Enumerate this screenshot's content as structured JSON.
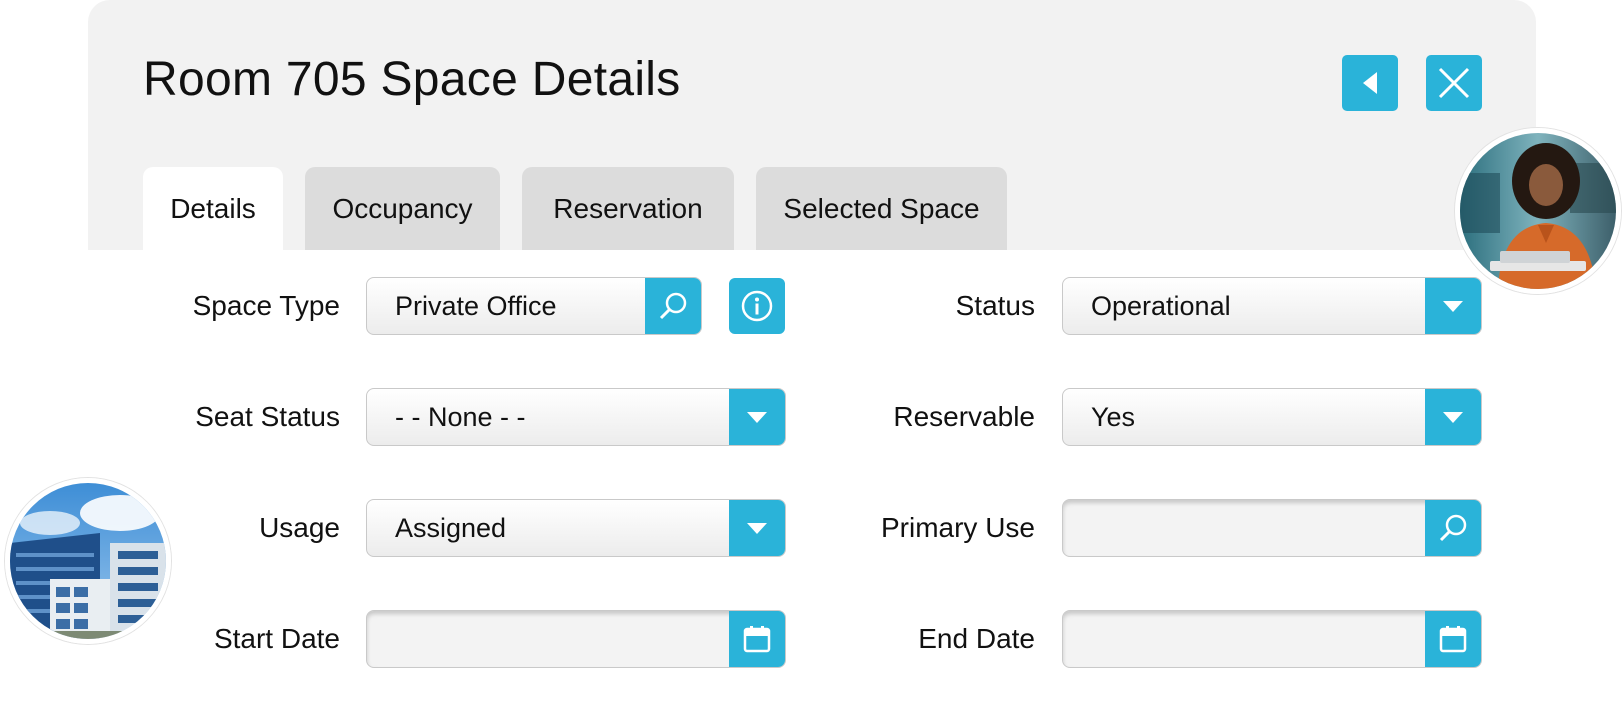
{
  "header": {
    "title": "Room 705 Space Details"
  },
  "tabs": [
    {
      "label": "Details"
    },
    {
      "label": "Occupancy"
    },
    {
      "label": "Reservation"
    },
    {
      "label": "Selected Space"
    }
  ],
  "form": {
    "space_type": {
      "label": "Space Type",
      "value": "Private Office"
    },
    "status": {
      "label": "Status",
      "value": "Operational"
    },
    "seat_status": {
      "label": "Seat Status",
      "value": "- - None - -"
    },
    "reservable": {
      "label": "Reservable",
      "value": "Yes"
    },
    "usage": {
      "label": "Usage",
      "value": "Assigned"
    },
    "primary_use": {
      "label": "Primary Use",
      "value": ""
    },
    "start_date": {
      "label": "Start Date",
      "value": ""
    },
    "end_date": {
      "label": "End Date",
      "value": ""
    }
  },
  "colors": {
    "accent": "#2ab3d9",
    "header_bg": "#f2f2f2",
    "tab_inactive": "#dcdcdc"
  }
}
